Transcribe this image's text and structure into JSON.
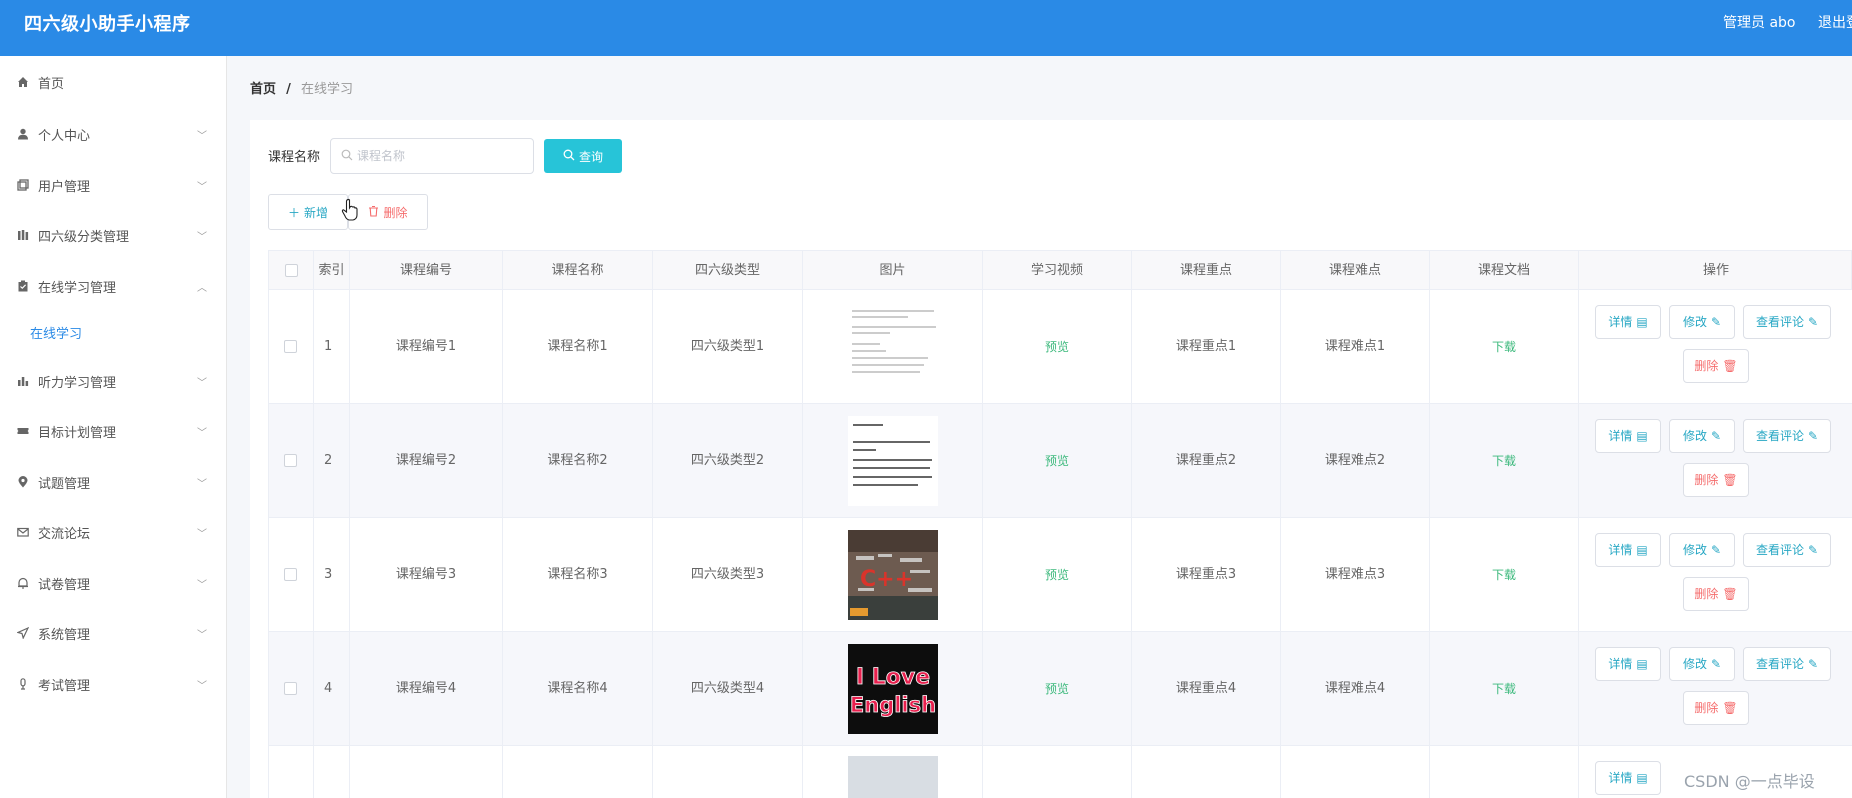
{
  "header": {
    "title": "四六级小助手小程序",
    "admin": "管理员 abo",
    "logout": "退出登"
  },
  "sidebar": {
    "items": [
      {
        "label": "首页",
        "icon": "home-icon"
      },
      {
        "label": "个人中心",
        "icon": "user-icon"
      },
      {
        "label": "用户管理",
        "icon": "copy-icon"
      },
      {
        "label": "四六级分类管理",
        "icon": "columns-icon"
      },
      {
        "label": "在线学习管理",
        "icon": "clipboard-icon",
        "expanded": true
      },
      {
        "label": "听力学习管理",
        "icon": "bar-chart-icon"
      },
      {
        "label": "目标计划管理",
        "icon": "ticket-icon"
      },
      {
        "label": "试题管理",
        "icon": "location-icon"
      },
      {
        "label": "交流论坛",
        "icon": "mail-icon"
      },
      {
        "label": "试卷管理",
        "icon": "bell-icon"
      },
      {
        "label": "系统管理",
        "icon": "send-icon"
      },
      {
        "label": "考试管理",
        "icon": "mic-icon"
      }
    ],
    "sub_item": "在线学习"
  },
  "breadcrumb": {
    "home": "首页",
    "separator": "/",
    "current": "在线学习"
  },
  "search": {
    "label": "课程名称",
    "placeholder": "课程名称",
    "value": "",
    "button": "查询"
  },
  "actions": {
    "add": "新增",
    "delete": "删除"
  },
  "table": {
    "headers": [
      "索引",
      "课程编号",
      "课程名称",
      "四六级类型",
      "图片",
      "学习视频",
      "课程重点",
      "课程难点",
      "课程文档",
      "操作"
    ],
    "rows": [
      {
        "index": "1",
        "code": "课程编号1",
        "name": "课程名称1",
        "type": "四六级类型1",
        "video": "预览",
        "key": "课程重点1",
        "difficulty": "课程难点1",
        "doc": "下载",
        "image": "text-page-image"
      },
      {
        "index": "2",
        "code": "课程编号2",
        "name": "课程名称2",
        "type": "四六级类型2",
        "video": "预览",
        "key": "课程重点2",
        "difficulty": "课程难点2",
        "doc": "下载",
        "image": "text-card-image"
      },
      {
        "index": "3",
        "code": "课程编号3",
        "name": "课程名称3",
        "type": "四六级类型3",
        "video": "预览",
        "key": "课程重点3",
        "difficulty": "课程难点3",
        "doc": "下载",
        "image": "cpp-wordcloud-image"
      },
      {
        "index": "4",
        "code": "课程编号4",
        "name": "课程名称4",
        "type": "四六级类型4",
        "video": "预览",
        "key": "课程重点4",
        "difficulty": "课程难点4",
        "doc": "下载",
        "image": "i-love-english-image"
      }
    ],
    "row_actions": {
      "detail": "详情",
      "edit": "修改",
      "comments": "查看评论",
      "delete": "删除"
    }
  },
  "watermark": "CSDN @一点毕设",
  "colors": {
    "header": "#2a8ae6",
    "query_button": "#27c4d8",
    "accent_text": "#27a7c4",
    "danger": "#f56c6c",
    "success": "#3cb97c"
  }
}
